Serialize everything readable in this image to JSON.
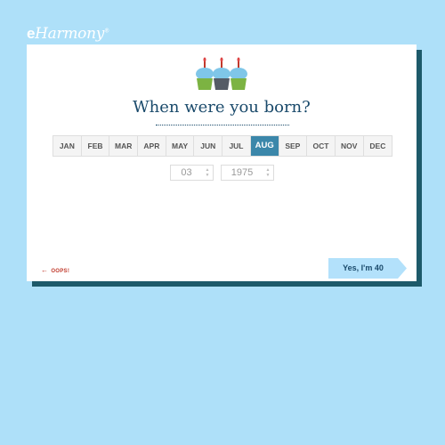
{
  "brand": {
    "logo_e": "e",
    "logo_rest": "Harmony",
    "logo_mark": "®"
  },
  "question": "When were you born?",
  "months": [
    "JAN",
    "FEB",
    "MAR",
    "APR",
    "MAY",
    "JUN",
    "JUL",
    "AUG",
    "SEP",
    "OCT",
    "NOV",
    "DEC"
  ],
  "selected_month": "AUG",
  "day": "03",
  "year": "1975",
  "oops_label": "OOPS!",
  "confirm_label": "Yes, I'm 40",
  "colors": {
    "background": "#aee0f9",
    "card_shadow": "#1d5a6a",
    "selected_month": "#3b87aa",
    "confirm_button": "#b3e1fb",
    "oops": "#c0392b",
    "heading": "#1a4a6b"
  },
  "icons": [
    "cupcakes-illustration",
    "back-arrow-icon",
    "stepper-arrows-icon"
  ]
}
